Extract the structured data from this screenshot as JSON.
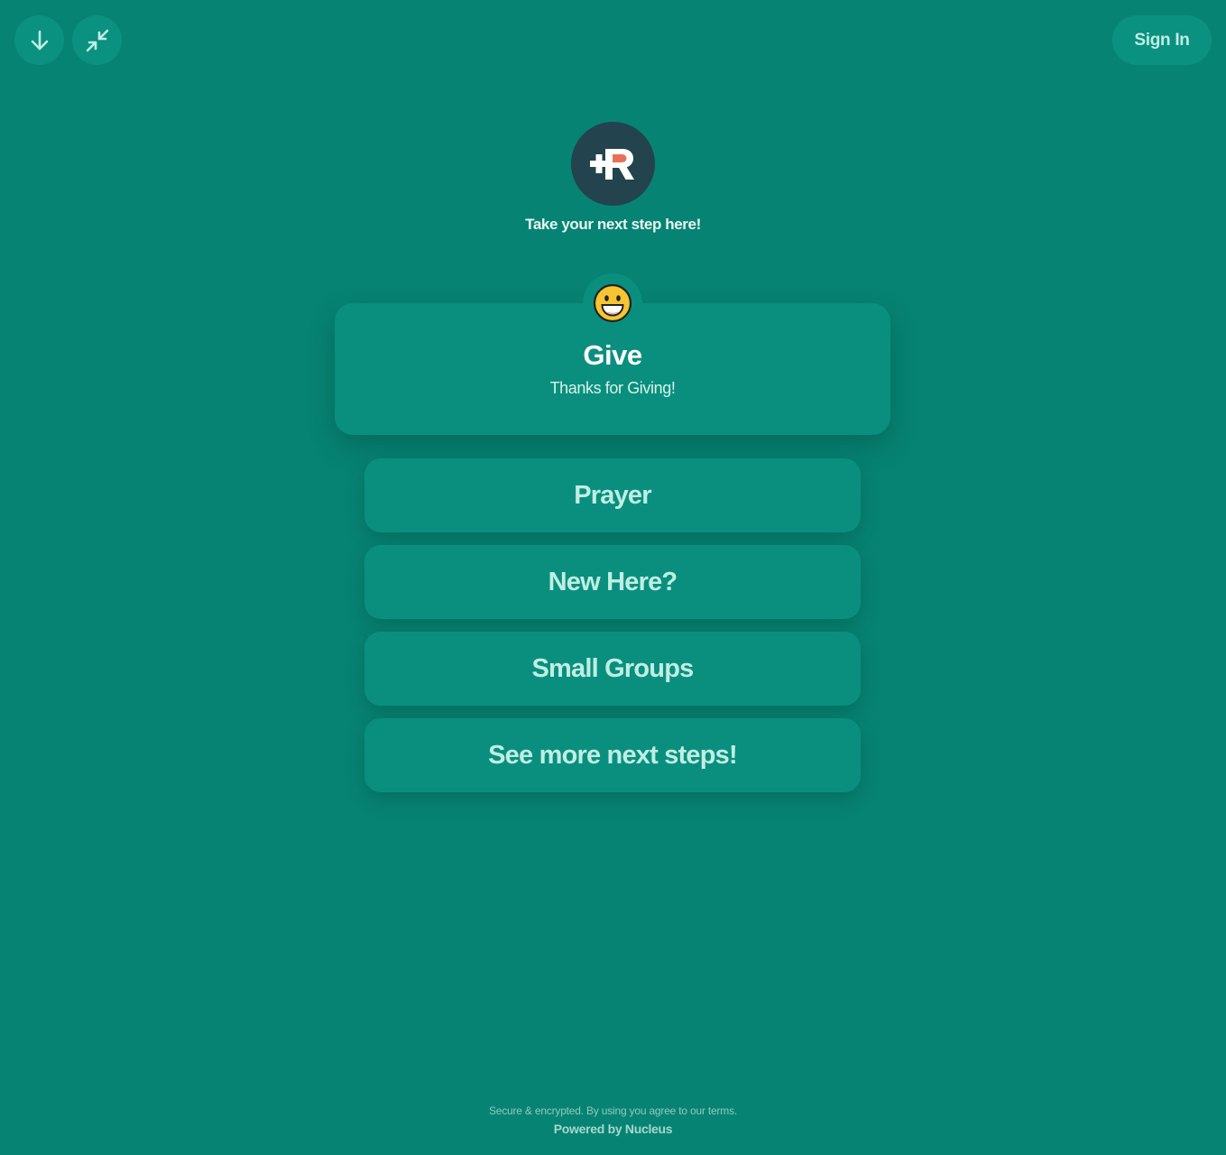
{
  "header": {
    "download_icon": "arrow-down-icon",
    "collapse_icon": "collapse-icon",
    "signin_label": "Sign In"
  },
  "brand": {
    "logo_icon": "plus-r-logo",
    "tagline": "Take your next step here!"
  },
  "featured": {
    "emoji": "grinning-face-icon",
    "title": "Give",
    "subtitle": "Thanks for Giving!"
  },
  "links": [
    {
      "label": "Prayer"
    },
    {
      "label": "New Here?"
    },
    {
      "label": "Small Groups"
    },
    {
      "label": "See more next steps!"
    }
  ],
  "footer": {
    "line1_text": "Secure & encrypted. By using you agree to our ",
    "terms_link": "terms.",
    "powered_by": "Powered by Nucleus"
  },
  "colors": {
    "background": "#078373",
    "card": "#0a8f7e",
    "logo_bg": "#23434e",
    "logo_accent": "#e8705a",
    "text_light": "#bfeee3"
  }
}
